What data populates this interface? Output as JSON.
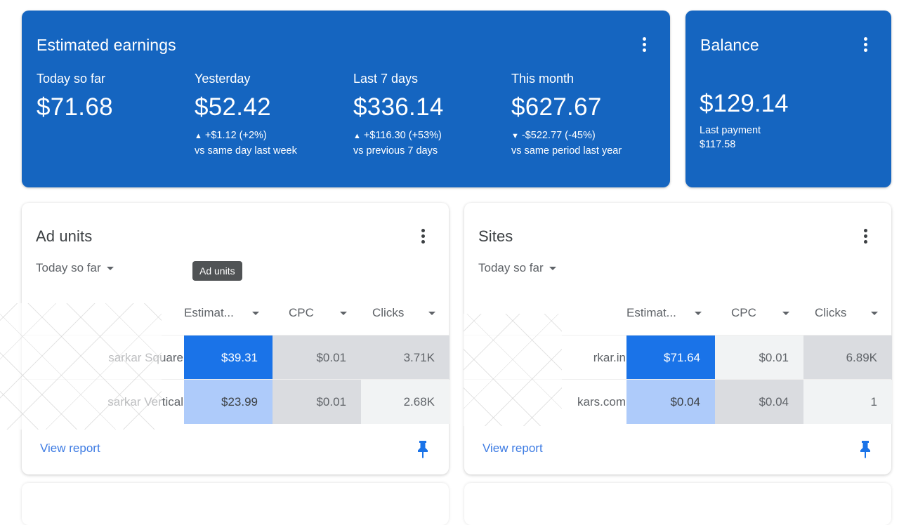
{
  "colors": {
    "primary_blue": "#1565c0",
    "heat_strong": "#1a73e8",
    "heat_light": "#aecbfa",
    "heat_gray_mid": "#dadce0",
    "heat_gray_light": "#f1f3f4",
    "link": "#3d7be3"
  },
  "earnings": {
    "title": "Estimated earnings",
    "menu_icon": "more-vert-icon",
    "metrics": [
      {
        "label": "Today so far",
        "value": "$71.68",
        "change": "",
        "direction": "",
        "compare": ""
      },
      {
        "label": "Yesterday",
        "value": "$52.42",
        "change": "+$1.12 (+2%)",
        "direction": "▲",
        "compare": "vs same day last week"
      },
      {
        "label": "Last 7 days",
        "value": "$336.14",
        "change": "+$116.30 (+53%)",
        "direction": "▲",
        "compare": "vs previous 7 days"
      },
      {
        "label": "This month",
        "value": "$627.67",
        "change": "-$522.77 (-45%)",
        "direction": "▼",
        "compare": "vs same period last year"
      }
    ]
  },
  "balance": {
    "title": "Balance",
    "value": "$129.14",
    "last_payment_label": "Last payment",
    "last_payment_value": "$117.58"
  },
  "ad_units": {
    "title": "Ad units",
    "range": "Today so far",
    "tooltip": "Ad units",
    "columns": [
      "Estimat...",
      "CPC",
      "Clicks"
    ],
    "rows": [
      {
        "name": "sarkar Square",
        "cells": [
          "$39.31",
          "$0.01",
          "3.71K"
        ],
        "shades": [
          "strong",
          "mid",
          "mid"
        ]
      },
      {
        "name": "sarkar Vertical",
        "cells": [
          "$23.99",
          "$0.01",
          "2.68K"
        ],
        "shades": [
          "light",
          "mid",
          "pale"
        ]
      }
    ],
    "view_report": "View report"
  },
  "sites": {
    "title": "Sites",
    "range": "Today so far",
    "columns": [
      "Estimat...",
      "CPC",
      "Clicks"
    ],
    "rows": [
      {
        "name": "rkar.in",
        "cells": [
          "$71.64",
          "$0.01",
          "6.89K"
        ],
        "shades": [
          "strong",
          "pale",
          "mid"
        ]
      },
      {
        "name": "kars.com",
        "cells": [
          "$0.04",
          "$0.04",
          "1"
        ],
        "shades": [
          "light",
          "mid",
          "pale"
        ]
      }
    ],
    "view_report": "View report"
  }
}
